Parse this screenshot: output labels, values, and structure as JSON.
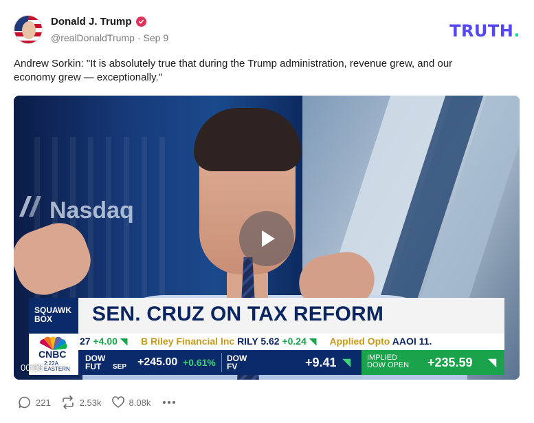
{
  "header": {
    "display_name": "Donald J. Trump",
    "handle": "@realDonaldTrump",
    "separator": "·",
    "date": "Sep 9",
    "brand_logo": "TRUTH",
    "brand_dot": ".",
    "brand_color": "#5448EE",
    "brand_dot_color": "#1FD7A2",
    "verified_color": "#E0335B"
  },
  "post": {
    "text": "Andrew Sorkin: \"It is absolutely true that during the Trump administration, revenue grew, and our economy grew — exceptionally.\""
  },
  "video": {
    "timestamp": "00:06",
    "background_text": "Nasdaq",
    "show_name_line1": "SQUAWK",
    "show_name_line2": "BOX",
    "headline": "SEN. CRUZ ON TAX REFORM",
    "network": "CNBC",
    "network_time_line1": "2:22A",
    "network_time_line2": "EASTERN",
    "ticker_top": {
      "item1_value": "27",
      "item1_change": "+4.00",
      "item2_name": "B Riley Financial Inc",
      "item2_symbol": "RILY",
      "item2_value": "5.62",
      "item2_change": "+0.24",
      "item3_name": "Applied Opto",
      "item3_symbol": "AAOI 11."
    },
    "ticker_bottom": {
      "dow_fut_label1": "DOW",
      "dow_fut_label2": "FUT",
      "dow_fut_month": "SEP",
      "dow_fut_value": "+245.00",
      "dow_fut_pct": "+0.61%",
      "dow_fv_label1": "DOW",
      "dow_fv_label2": "FV",
      "dow_fv_value": "+9.41",
      "implied_label1": "IMPLIED",
      "implied_label2": "DOW OPEN",
      "implied_value": "+235.59"
    },
    "play_icon": "play-icon"
  },
  "actions": {
    "replies": "221",
    "retruths": "2.53k",
    "likes": "8.08k"
  }
}
